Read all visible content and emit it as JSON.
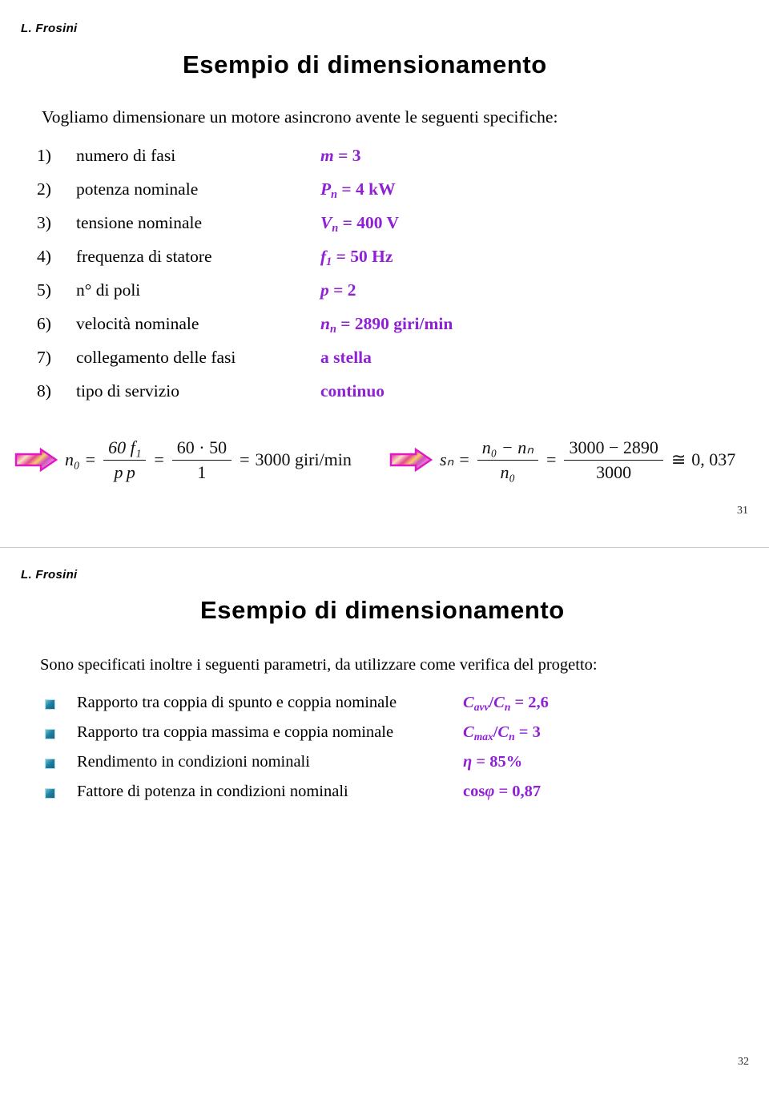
{
  "document": {
    "author": "L. Frosini",
    "accent_purple": "#8f20d6",
    "bullet_teal": "#1e7fa0",
    "arrow_magenta": "#e018c8"
  },
  "slide1": {
    "author": "L. Frosini",
    "title": "Esempio di dimensionamento",
    "intro": "Vogliamo dimensionare un motore asincrono avente le seguenti specifiche:",
    "page_number": "31",
    "specs": [
      {
        "num": "1)",
        "label": "numero di fasi",
        "value_html": "<span class=\"var\">m</span> <span class=\"up\">= 3</span>"
      },
      {
        "num": "2)",
        "label": "potenza nominale",
        "value_html": "<span class=\"var\">P<sub>n</sub></span> <span class=\"up\">= 4 kW</span>"
      },
      {
        "num": "3)",
        "label": "tensione nominale",
        "value_html": "<span class=\"var\">V<sub>n</sub></span> <span class=\"up\">= 400 V</span>"
      },
      {
        "num": "4)",
        "label": "frequenza di statore",
        "value_html": "<span class=\"var\">f<sub>1</sub></span> <span class=\"up\">= 50 Hz</span>"
      },
      {
        "num": "5)",
        "label": "n° di poli",
        "value_html": "<span class=\"var\">p</span> <span class=\"up\">= 2</span>"
      },
      {
        "num": "6)",
        "label": "velocità nominale",
        "value_html": "<span class=\"var\">n<sub>n</sub></span> <span class=\"up\">= 2890 giri/min</span>"
      },
      {
        "num": "7)",
        "label": "collegamento delle fasi",
        "value_html": "<span class=\"up\">a stella</span>"
      },
      {
        "num": "8)",
        "label": "tipo di servizio",
        "value_html": "<span class=\"up\">continuo</span>"
      }
    ],
    "formula_n0": {
      "lhs": "n₀",
      "numerator_1": "60 f₁",
      "denominator_1": "p p",
      "numerator_2": "60 · 50",
      "denominator_2": "1",
      "result": "3000 giri/min",
      "text": "n₀ = 60 f₁ / p p = 60·50 / 1 = 3000 giri/min"
    },
    "formula_sn": {
      "lhs": "sₙ",
      "numerator_1": "n₀ − nₙ",
      "denominator_1": "n₀",
      "numerator_2": "3000 − 2890",
      "denominator_2": "3000",
      "approx_symbol": "≅",
      "result": "0, 037",
      "text": "sₙ = (n₀ − nₙ)/n₀ = (3000 − 2890)/3000 ≅ 0,037"
    }
  },
  "slide2": {
    "author": "L. Frosini",
    "title": "Esempio di dimensionamento",
    "intro": "Sono specificati inoltre i seguenti parametri, da utilizzare come verifica del progetto:",
    "page_number": "32",
    "params": [
      {
        "label": "Rapporto tra coppia di spunto e coppia nominale",
        "value_html": "<span class=\"var\">C<sub>avv</sub></span><span class=\"up\">/</span><span class=\"var\">C<sub>n</sub></span> <span class=\"up\">= 2,6</span>",
        "value_text": "C_avv/C_n = 2,6"
      },
      {
        "label": "Rapporto tra coppia massima e coppia nominale",
        "value_html": "<span class=\"var\">C<sub>max</sub></span><span class=\"up\">/</span><span class=\"var\">C<sub>n</sub></span> <span class=\"up\">= 3</span>",
        "value_text": "C_max/C_n = 3"
      },
      {
        "label": "Rendimento in condizioni nominali",
        "value_html": "<span class=\"var\">η</span> <span class=\"up\">= 85%</span>",
        "value_text": "η = 85%"
      },
      {
        "label": "Fattore di potenza in condizioni nominali",
        "value_html": "<span class=\"up\">cos</span><span class=\"var\">φ</span> <span class=\"up\">= 0,87</span>",
        "value_text": "cosφ = 0,87"
      }
    ]
  }
}
